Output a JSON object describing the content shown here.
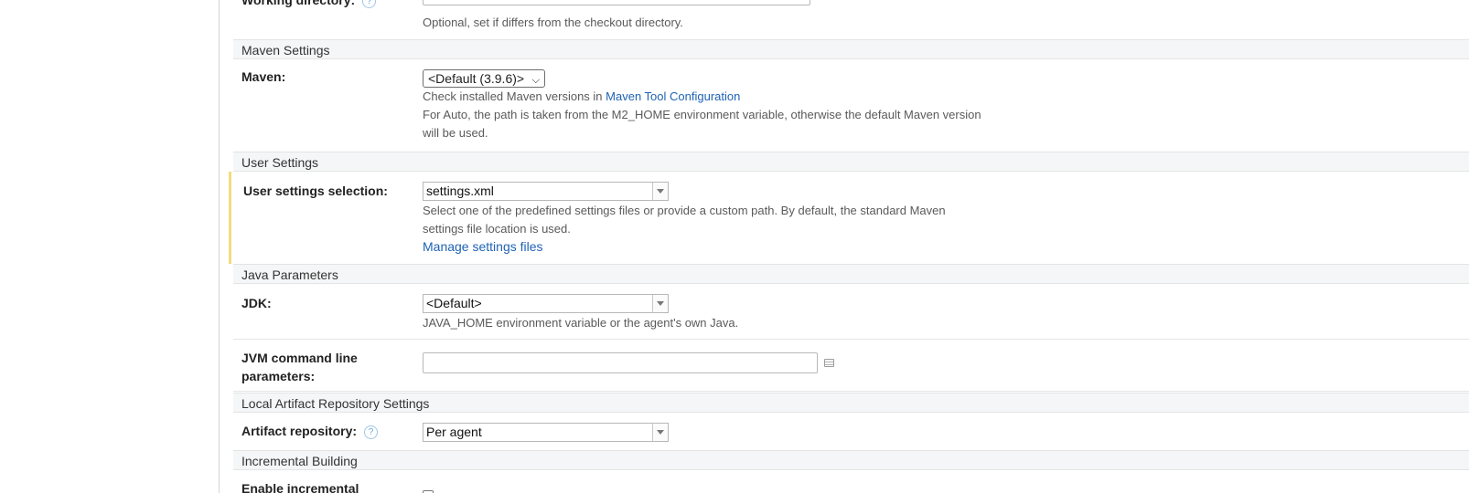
{
  "working_directory": {
    "label": "Working directory:",
    "value": "",
    "hint": "Optional, set if differs from the checkout directory."
  },
  "maven_settings": {
    "header": "Maven Settings",
    "maven_label": "Maven:",
    "maven_selected": "<Default (3.9.6)>",
    "hint_prefix": "Check installed Maven versions in ",
    "hint_link": "Maven Tool Configuration",
    "hint_auto": "For Auto, the path is taken from the M2_HOME environment variable, otherwise the default Maven version will be used."
  },
  "user_settings": {
    "header": "User Settings",
    "label": "User settings selection:",
    "selected": "settings.xml",
    "hint": "Select one of the predefined settings files or provide a custom path. By default, the standard Maven settings file location is used.",
    "manage_link": "Manage settings files"
  },
  "java_parameters": {
    "header": "Java Parameters",
    "jdk_label": "JDK:",
    "jdk_selected": "<Default>",
    "jdk_hint": "JAVA_HOME environment variable or the agent's own Java.",
    "jvm_label": "JVM command line parameters:",
    "jvm_value": ""
  },
  "local_artifact": {
    "header": "Local Artifact Repository Settings",
    "label": "Artifact repository:",
    "selected": "Per agent"
  },
  "incremental": {
    "header": "Incremental Building",
    "label": "Enable incremental"
  },
  "icons": {
    "help": "help-icon",
    "list": "list-icon",
    "tree": "tree-icon",
    "dropdown": "chevron-down-icon"
  },
  "colors": {
    "link": "#2063b5",
    "highlight": "#f3dc7e",
    "section_bg": "#f5f6f7"
  }
}
